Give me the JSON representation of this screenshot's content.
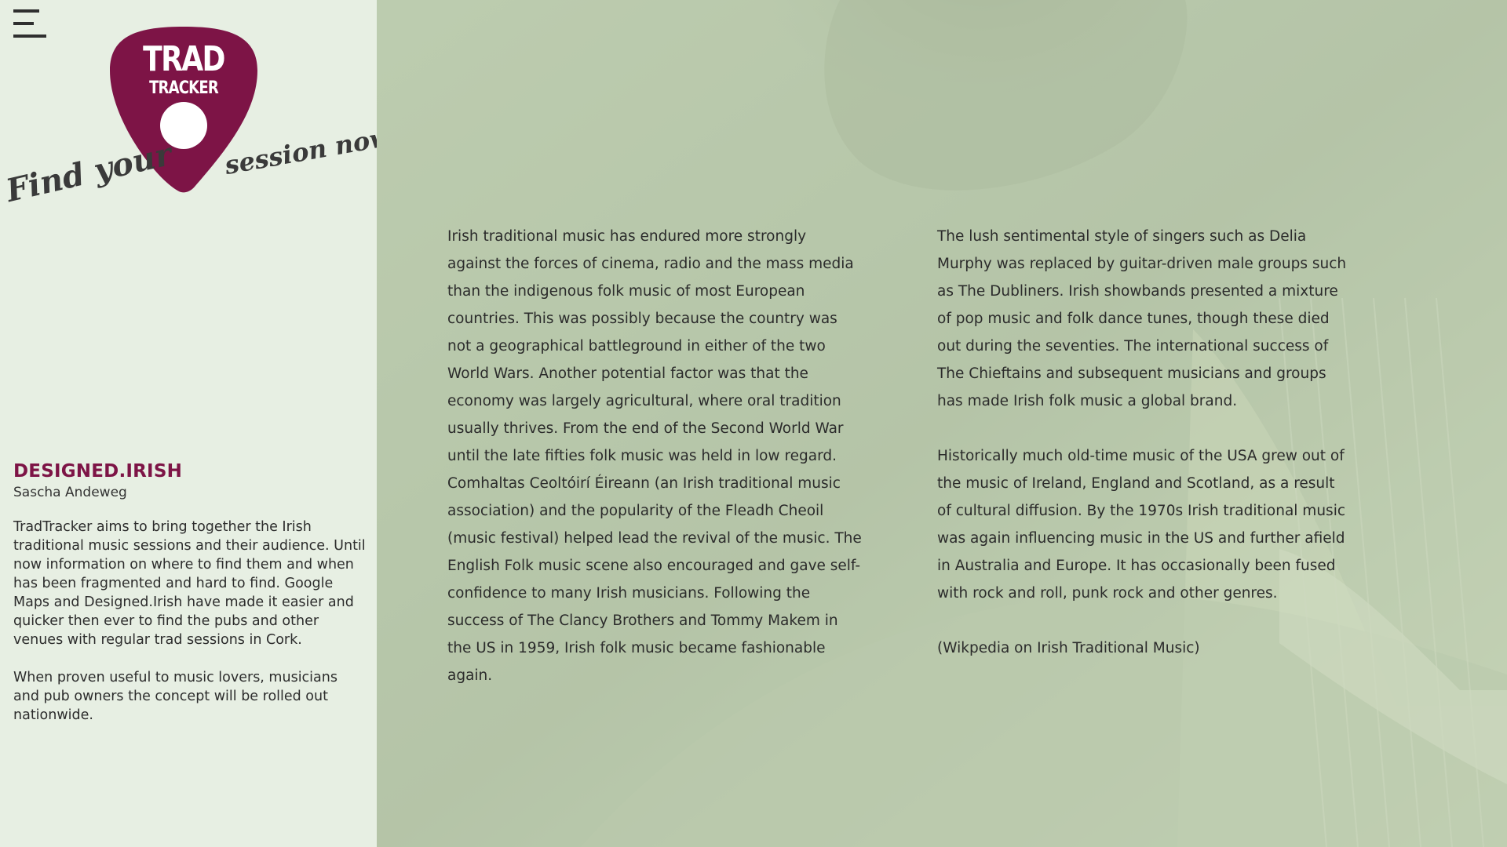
{
  "menu": {
    "icon": "hamburger-menu-icon"
  },
  "logo": {
    "line1": "TRAD",
    "line2": "TRACKER",
    "color": "#7d1446",
    "shape": "guitar-pick-icon"
  },
  "tagline": {
    "left": "Find your",
    "right": "session now"
  },
  "sidebar": {
    "brand": "DESIGNED.IRISH",
    "author": "Sascha Andeweg",
    "paragraph1": "TradTracker aims to bring together the Irish traditional music sessions and their audience. Until now information on where to find them and when has been fragmented and hard to find. Google Maps and Designed.Irish have made it easier and quicker then ever to find the pubs and other venues with regular trad sessions in Cork.",
    "paragraph2": "When proven useful to music lovers, musicians and pub owners the concept will be rolled out nationwide."
  },
  "main": {
    "column_left": "Irish traditional music has endured more strongly against the forces of cinema, radio and the mass media than the indigenous folk music of most European countries. This was possibly because the country was not a geographical battleground in either of the two World Wars. Another potential factor was that the economy was largely agricultural, where oral tradition usually thrives. From the end of the Second World War until the late fifties folk music was held in low regard. Comhaltas Ceoltóirí Éireann (an Irish traditional music association) and the popularity of the Fleadh Cheoil (music festival) helped lead the revival of the music. The English Folk music scene also encouraged and gave self-confidence to many Irish musicians. Following the success of The Clancy Brothers and Tommy Makem in the US in 1959, Irish folk music became fashionable again.",
    "column_right_p1": "The lush sentimental style of singers such as Delia Murphy was replaced by guitar-driven male groups such as The Dubliners. Irish showbands presented a mixture of pop music and folk dance tunes, though these died out during the seventies. The international success of The Chieftains and subsequent musicians and groups has made Irish folk music a global brand.",
    "column_right_p2": "Historically much old-time music of the USA grew out of the music of Ireland, England and Scotland, as a result of cultural diffusion. By the 1970s Irish traditional music was again influencing music in the US and further afield in Australia and Europe. It has occasionally been fused with rock and roll, punk rock and other genres.",
    "source": "(Wikpedia on Irish Traditional Music)"
  },
  "colors": {
    "sidebar_bg": "#e7efe3",
    "brand": "#7d1446",
    "overlay": "#c3d3b5"
  }
}
